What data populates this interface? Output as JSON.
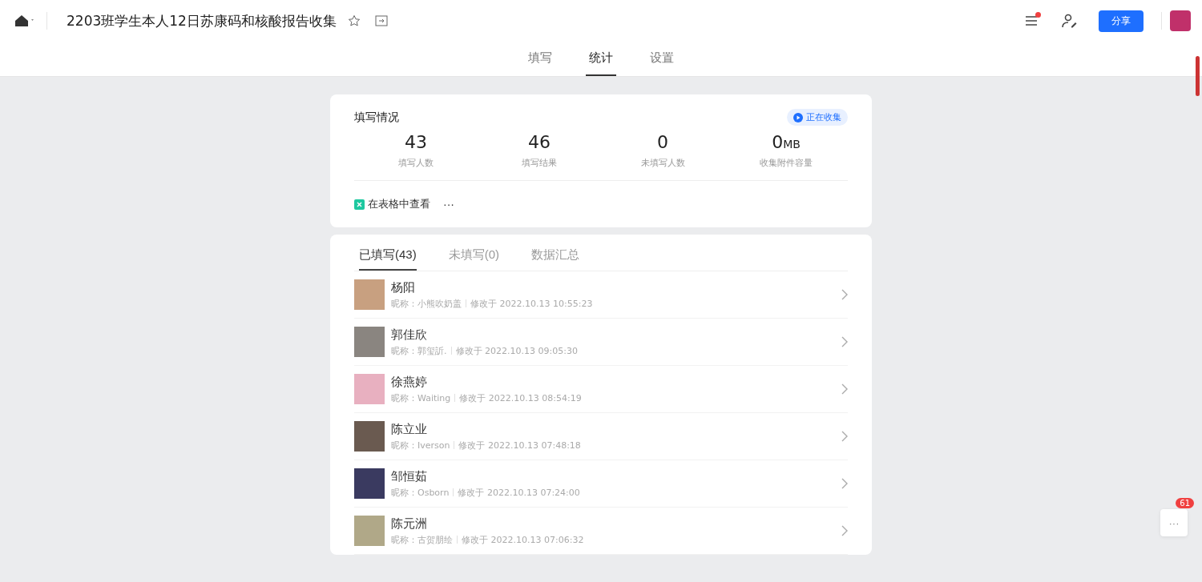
{
  "header": {
    "title": "2203班学生本人12日苏康码和核酸报告收集",
    "share_button": "分享",
    "menu_has_dot": true
  },
  "view_tabs": [
    {
      "label": "填写",
      "selected": false
    },
    {
      "label": "统计",
      "selected": true
    },
    {
      "label": "设置",
      "selected": false
    }
  ],
  "summary": {
    "title": "填写情况",
    "status": "正在收集",
    "stats": [
      {
        "value": "43",
        "label": "填写人数"
      },
      {
        "value": "46",
        "label": "填写结果"
      },
      {
        "value": "0",
        "label": "未填写人数"
      },
      {
        "value": "0",
        "unit": "MB",
        "label": "收集附件容量"
      }
    ],
    "sheet_link": "在表格中查看",
    "more": "···"
  },
  "list_tabs": [
    {
      "label": "已填写(43)",
      "selected": true
    },
    {
      "label": "未填写(0)",
      "selected": false
    },
    {
      "label": "数据汇总",
      "selected": false
    }
  ],
  "responses": [
    {
      "name": "杨阳",
      "nickname": "昵称：小熊吹奶盖",
      "modified": "修改于 2022.10.13 10:55:23",
      "color": "#c8a080"
    },
    {
      "name": "郭佳欣",
      "nickname": "昵称：郭玺訢.",
      "modified": "修改于 2022.10.13 09:05:30",
      "color": "#8a8580"
    },
    {
      "name": "徐燕婷",
      "nickname": "昵称：Waiting",
      "modified": "修改于 2022.10.13 08:54:19",
      "color": "#e8b0c0"
    },
    {
      "name": "陈立业",
      "nickname": "昵称：Iverson",
      "modified": "修改于 2022.10.13 07:48:18",
      "color": "#6a5a50"
    },
    {
      "name": "邹恒茹",
      "nickname": "昵称：Osborn",
      "modified": "修改于 2022.10.13 07:24:00",
      "color": "#3a3a60"
    },
    {
      "name": "陈元洲",
      "nickname": "昵称：古贺朋绘",
      "modified": "修改于 2022.10.13 07:06:32",
      "color": "#b0a888"
    }
  ],
  "float_button": {
    "more": "···",
    "badge": "61"
  }
}
